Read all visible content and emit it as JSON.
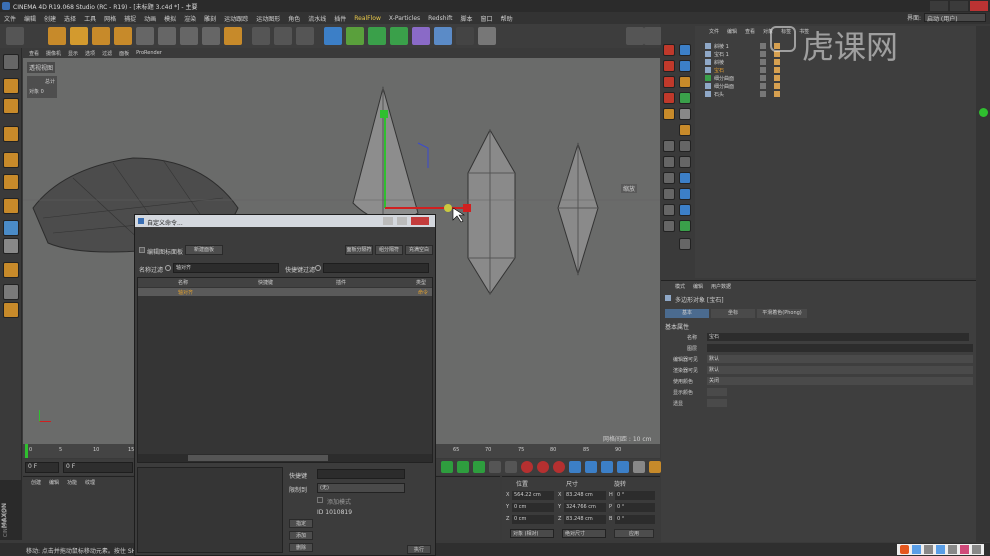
{
  "window": {
    "title": "CINEMA 4D R19.068 Studio (RC - R19) - [未标题 3.c4d *] - 主要"
  },
  "menubar": [
    "文件",
    "编辑",
    "创建",
    "选择",
    "工具",
    "网格",
    "捕捉",
    "动画",
    "模拟",
    "渲染",
    "雕刻",
    "运动跟踪",
    "运动图形",
    "角色",
    "流水线",
    "插件",
    "RealFlow",
    "X-Particles",
    "Redshift",
    "脚本",
    "窗口",
    "帮助"
  ],
  "layout": {
    "label": "界面:",
    "value": "启动 (用户)"
  },
  "viewport": {
    "menu": [
      "查看",
      "摄像机",
      "显示",
      "选项",
      "过滤",
      "面板",
      "ProRender"
    ],
    "title": "透视视图",
    "stats_label": "总计",
    "stats_objects": "对象 0",
    "axis_label": "缩放",
    "grid_spacing": "网格间距 : 10 cm"
  },
  "timeline": {
    "ticks": [
      "0",
      "5",
      "10",
      "15",
      "65",
      "70",
      "75",
      "80",
      "85",
      "90"
    ],
    "frame_field": "0 F",
    "start_field": "0 F"
  },
  "material_panel": {
    "menu": [
      "创建",
      "编辑",
      "功能",
      "纹理"
    ]
  },
  "dialog": {
    "title": "自定义命令...",
    "checkbox_label": "编辑图标面板",
    "new_panel_btn": "新建面板",
    "right_buttons": [
      "面板分隔符",
      "组分隔符",
      "充满空白"
    ],
    "name_filter_label": "名称过滤",
    "name_filter_value": "轴对齐",
    "shortcut_filter_label": "快捷键过滤",
    "columns": [
      "名称",
      "快捷键",
      "插件",
      "类型"
    ],
    "row": {
      "name": "轴对齐",
      "type": "命令"
    },
    "shortcut_label": "快捷键",
    "limit_label": "限制到",
    "limit_value": "(无)",
    "add_mode_label": "添加模式",
    "id_text": "ID 1010819",
    "btn_assign": "指定",
    "btn_add": "添加",
    "btn_delete": "删除",
    "btn_execute": "执行"
  },
  "object_manager": {
    "menu": [
      "文件",
      "编辑",
      "查看",
      "对象",
      "标签",
      "书签"
    ],
    "items": [
      {
        "name": "斜棱 1",
        "selected": false
      },
      {
        "name": "宝石 1",
        "selected": false
      },
      {
        "name": "斜棱",
        "selected": false
      },
      {
        "name": "宝石",
        "selected": true
      },
      {
        "name": "细分曲面",
        "selected": false
      },
      {
        "name": "细分曲面",
        "selected": false
      },
      {
        "name": "石头",
        "selected": false
      }
    ]
  },
  "attributes": {
    "menu": [
      "模式",
      "编辑",
      "用户数据"
    ],
    "object_title": "多边形对象 [宝石]",
    "tabs": [
      "基本",
      "坐标",
      "平滑着色(Phong)"
    ],
    "section": "基本属性",
    "fields": [
      {
        "label": "名称",
        "value": "宝石"
      },
      {
        "label": "图层",
        "value": ""
      },
      {
        "label": "编辑器可见",
        "value": "默认"
      },
      {
        "label": "渲染器可见",
        "value": "默认"
      },
      {
        "label": "使用颜色",
        "value": "关闭"
      },
      {
        "label": "显示颜色",
        "value": ""
      },
      {
        "label": "透显",
        "value": ""
      }
    ]
  },
  "coords": {
    "headers": [
      "位置",
      "尺寸",
      "旋转"
    ],
    "rows": [
      {
        "axis": "X",
        "pos": "564.22 cm",
        "axis2": "X",
        "size": "83.248 cm",
        "axis3": "H",
        "rot": "0 °"
      },
      {
        "axis": "Y",
        "pos": "0 cm",
        "axis2": "Y",
        "size": "324.766 cm",
        "axis3": "P",
        "rot": "0 °"
      },
      {
        "axis": "Z",
        "pos": "0 cm",
        "axis2": "Z",
        "size": "83.248 cm",
        "axis3": "B",
        "rot": "0 °"
      }
    ],
    "mode1": "对象 (相对)",
    "mode2": "绝对尺寸",
    "apply": "应用"
  },
  "status": {
    "text": "移动: 点击并拖动鼠标移动元素。按住 SHIFT 键"
  },
  "brand": {
    "maxon": "MAXON",
    "product": "CINEMA 4D"
  },
  "watermark": "虎课网"
}
